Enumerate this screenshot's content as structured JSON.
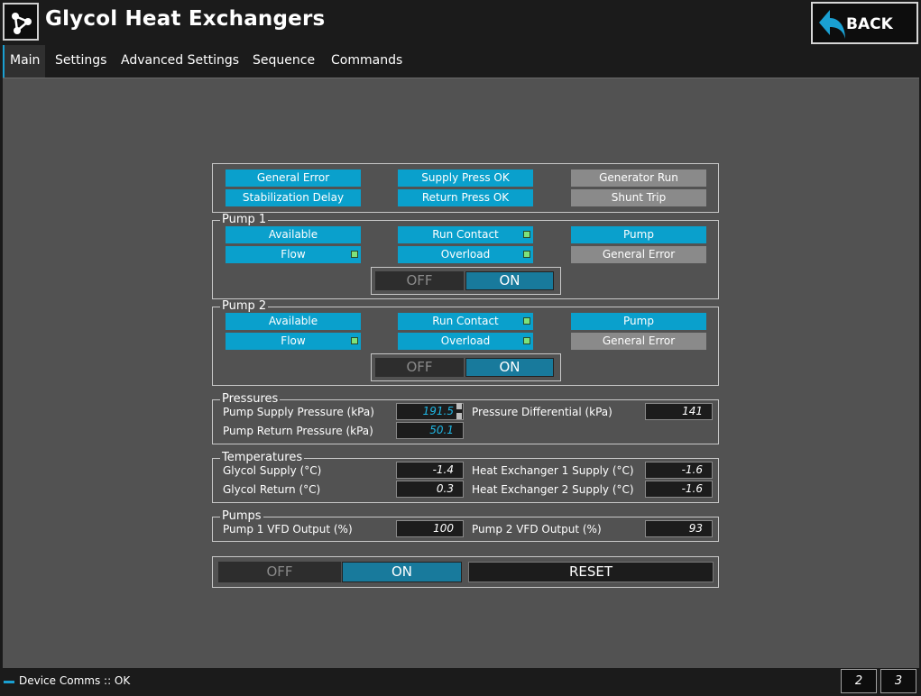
{
  "header": {
    "title": "Glycol Heat Exchangers",
    "app_icon": "network-nodes-icon",
    "back_label": "BACK",
    "back_icon": "back-arrow-icon"
  },
  "tabs": [
    {
      "label": "Main",
      "active": true
    },
    {
      "label": "Settings",
      "active": false
    },
    {
      "label": "Advanced Settings",
      "active": false
    },
    {
      "label": "Sequence",
      "active": false
    },
    {
      "label": "Commands",
      "active": false
    }
  ],
  "status_indicators": [
    {
      "label": "General Error",
      "state": "active"
    },
    {
      "label": "Supply Press OK",
      "state": "active"
    },
    {
      "label": "Generator Run",
      "state": "inactive"
    },
    {
      "label": "Stabilization Delay",
      "state": "active"
    },
    {
      "label": "Return Press OK",
      "state": "active"
    },
    {
      "label": "Shunt Trip",
      "state": "inactive"
    }
  ],
  "pump1": {
    "title": "Pump 1",
    "available": "Available",
    "run_contact": "Run Contact",
    "pump": "Pump",
    "flow": "Flow",
    "overload": "Overload",
    "general_error": "General Error",
    "toggle_off": "OFF",
    "toggle_on": "ON"
  },
  "pump2": {
    "title": "Pump 2",
    "available": "Available",
    "run_contact": "Run Contact",
    "pump": "Pump",
    "flow": "Flow",
    "overload": "Overload",
    "general_error": "General Error",
    "toggle_off": "OFF",
    "toggle_on": "ON"
  },
  "pressures": {
    "title": "Pressures",
    "supply_label": "Pump Supply Pressure (kPa)",
    "supply_value": "191.5",
    "return_label": "Pump Return Pressure (kPa)",
    "return_value": "50.1",
    "differential_label": "Pressure Differential (kPa)",
    "differential_value": "141"
  },
  "temperatures": {
    "title": "Temperatures",
    "glycol_supply_label": "Glycol Supply (°C)",
    "glycol_supply_value": "-1.4",
    "glycol_return_label": "Glycol Return (°C)",
    "glycol_return_value": "0.3",
    "hx1_label": "Heat Exchanger 1 Supply (°C)",
    "hx1_value": "-1.6",
    "hx2_label": "Heat Exchanger 2 Supply (°C)",
    "hx2_value": "-1.6"
  },
  "pumps": {
    "title": "Pumps",
    "vfd1_label": "Pump 1 VFD Output (%)",
    "vfd1_value": "100",
    "vfd2_label": "Pump 2 VFD Output (%)",
    "vfd2_value": "93"
  },
  "controls": {
    "off_label": "OFF",
    "on_label": "ON",
    "reset_label": "RESET"
  },
  "statusbar": {
    "text": "Device Comms :: OK",
    "page2": "2",
    "page3": "3"
  },
  "colors": {
    "accent": "#1aa0d2",
    "indicator_active": "#0aa0cc",
    "indicator_inactive": "#8a8a8a",
    "led_on": "#7ee27a",
    "panel_bg": "#525252"
  }
}
